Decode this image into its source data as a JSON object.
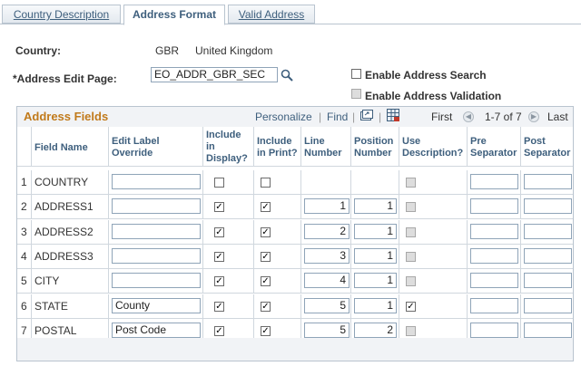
{
  "tabs": [
    {
      "label": "Country Description",
      "active": false
    },
    {
      "label": "Address Format",
      "active": true
    },
    {
      "label": "Valid Address",
      "active": false
    }
  ],
  "country": {
    "label": "Country:",
    "code": "GBR",
    "name": "United Kingdom"
  },
  "address_edit_page": {
    "label": "*Address Edit Page:",
    "value": "EO_ADDR_GBR_SEC"
  },
  "options": {
    "enable_search": {
      "label": "Enable Address Search",
      "checked": false
    },
    "enable_validation": {
      "label": "Enable Address Validation",
      "checked": false
    }
  },
  "grid": {
    "title": "Address Fields",
    "personalize": "Personalize",
    "find": "Find",
    "first": "First",
    "range": "1-7 of 7",
    "last": "Last",
    "columns": {
      "field_name": "Field Name",
      "edit_label": "Edit Label Override",
      "include_display": "Include in Display?",
      "include_print": "Include in Print?",
      "line_number": "Line Number",
      "position_number": "Position Number",
      "use_description": "Use Description?",
      "pre_separator": "Pre Separator",
      "post_separator": "Post Separator"
    },
    "rows": [
      {
        "n": "1",
        "field": "COUNTRY",
        "label": "",
        "display": false,
        "print": false,
        "line": "",
        "pos": "",
        "desc": false,
        "pre": "",
        "post": ""
      },
      {
        "n": "2",
        "field": "ADDRESS1",
        "label": "",
        "display": true,
        "print": true,
        "line": "1",
        "pos": "1",
        "desc": false,
        "pre": "",
        "post": ""
      },
      {
        "n": "3",
        "field": "ADDRESS2",
        "label": "",
        "display": true,
        "print": true,
        "line": "2",
        "pos": "1",
        "desc": false,
        "pre": "",
        "post": ""
      },
      {
        "n": "4",
        "field": "ADDRESS3",
        "label": "",
        "display": true,
        "print": true,
        "line": "3",
        "pos": "1",
        "desc": false,
        "pre": "",
        "post": ""
      },
      {
        "n": "5",
        "field": "CITY",
        "label": "",
        "display": true,
        "print": true,
        "line": "4",
        "pos": "1",
        "desc": false,
        "pre": "",
        "post": ""
      },
      {
        "n": "6",
        "field": "STATE",
        "label": "County",
        "display": true,
        "print": true,
        "line": "5",
        "pos": "1",
        "desc": true,
        "pre": "",
        "post": ""
      },
      {
        "n": "7",
        "field": "POSTAL",
        "label": "Post Code",
        "display": true,
        "print": true,
        "line": "5",
        "pos": "2",
        "desc": false,
        "pre": "",
        "post": ""
      }
    ]
  }
}
